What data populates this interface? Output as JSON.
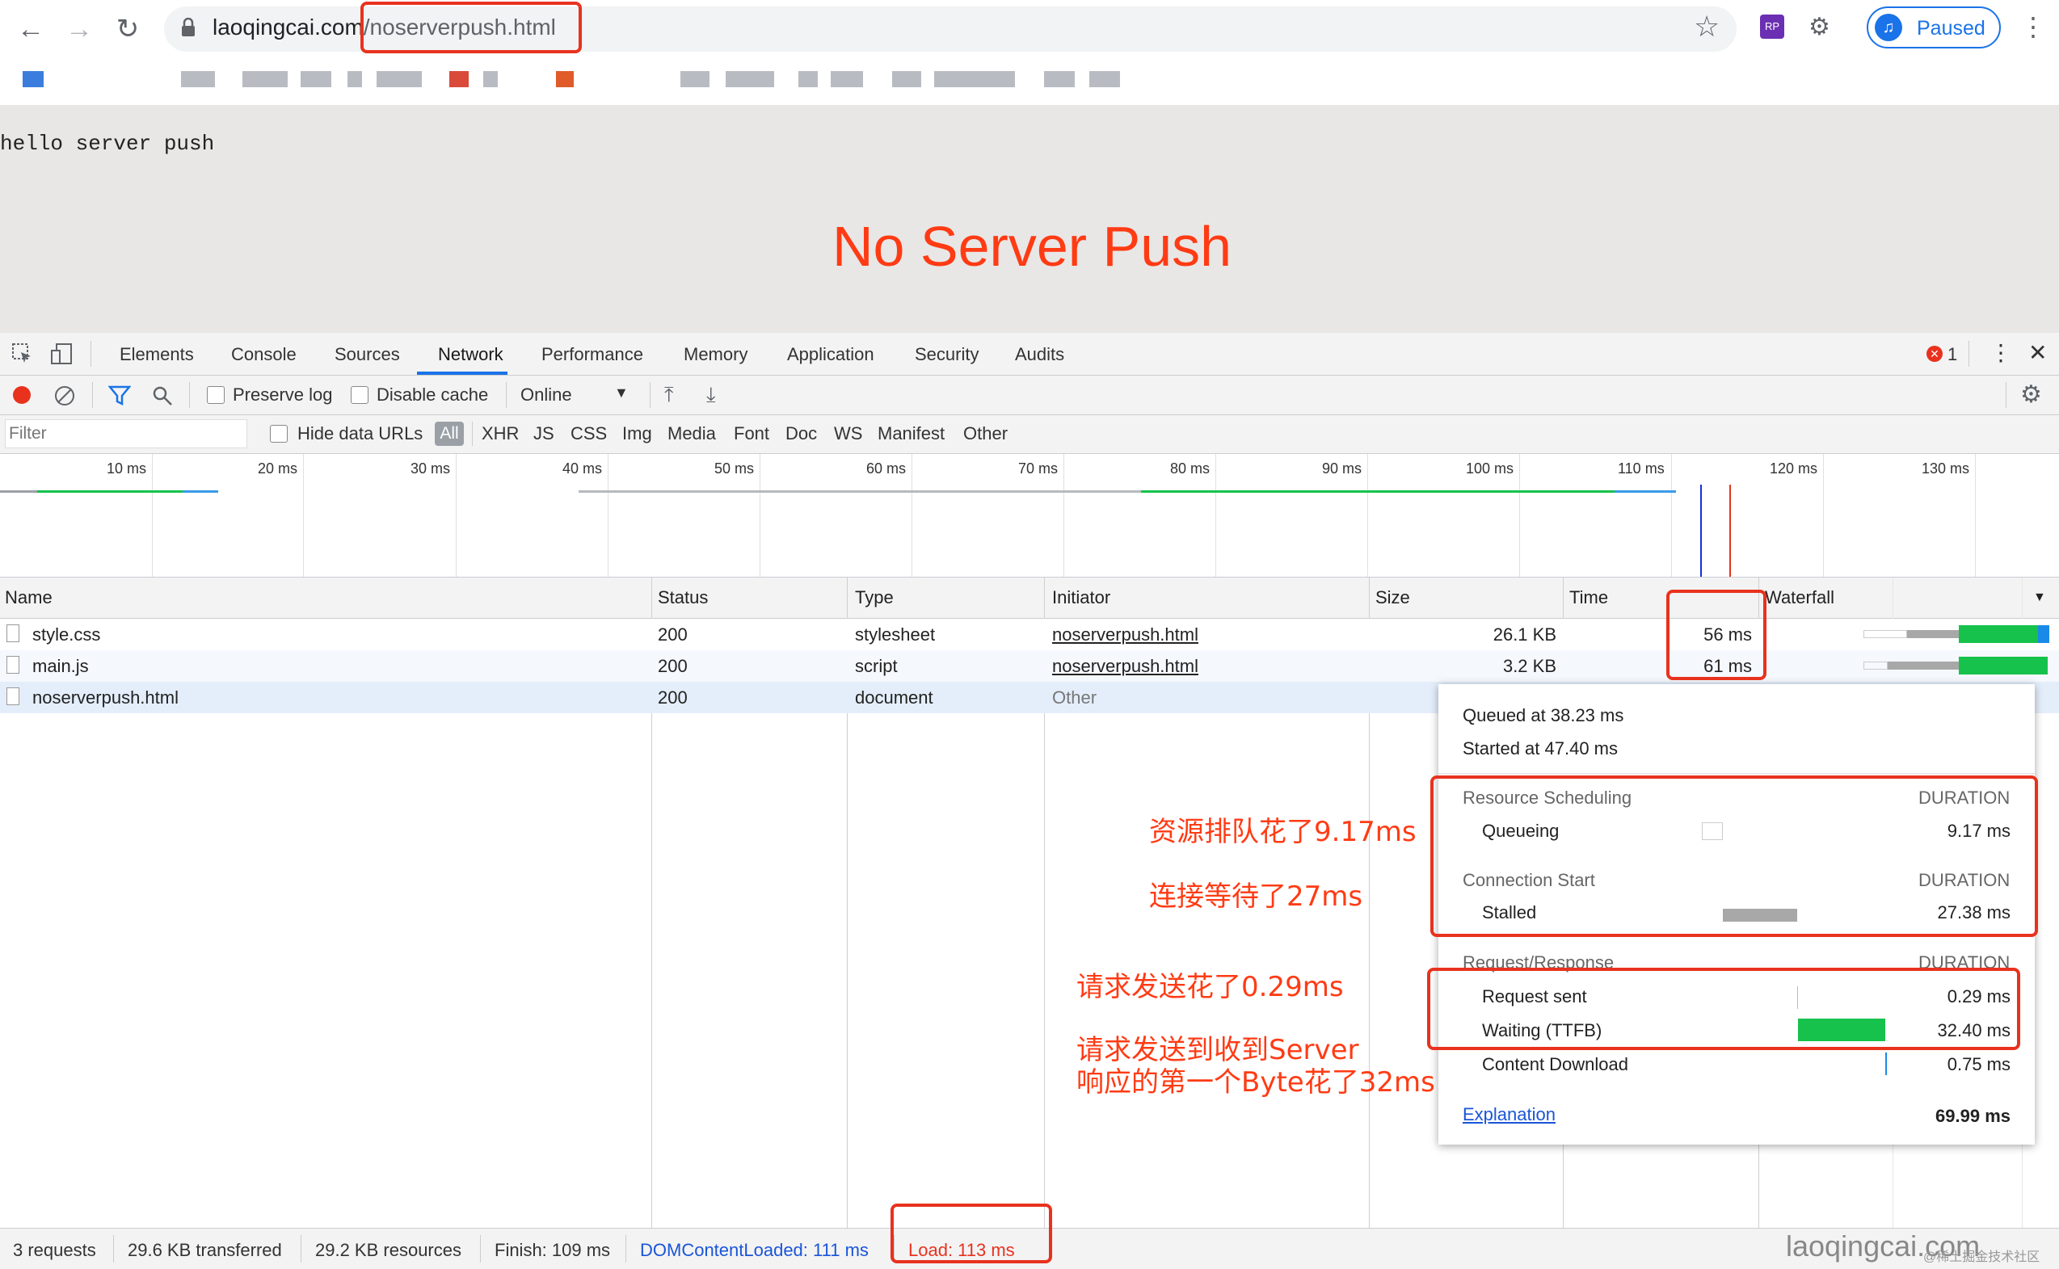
{
  "browser": {
    "url_host": "laoqingcai.com",
    "url_path": "/noserverpush.html",
    "profile_label": "Paused",
    "extension_label": "RP"
  },
  "page": {
    "body_text": "hello server push",
    "heading": "No Server Push"
  },
  "devtools": {
    "tabs": [
      "Elements",
      "Console",
      "Sources",
      "Network",
      "Performance",
      "Memory",
      "Application",
      "Security",
      "Audits"
    ],
    "active_tab": "Network",
    "error_count": "1",
    "toolbar": {
      "preserve_log": "Preserve log",
      "disable_cache": "Disable cache",
      "throttle": "Online"
    },
    "filter": {
      "placeholder": "Filter",
      "hide_data_urls": "Hide data URLs",
      "all": "All",
      "types": [
        "XHR",
        "JS",
        "CSS",
        "Img",
        "Media",
        "Font",
        "Doc",
        "WS",
        "Manifest",
        "Other"
      ]
    },
    "overview_ticks": [
      "10 ms",
      "20 ms",
      "30 ms",
      "40 ms",
      "50 ms",
      "60 ms",
      "70 ms",
      "80 ms",
      "90 ms",
      "100 ms",
      "110 ms",
      "120 ms",
      "130 ms"
    ],
    "columns": [
      "Name",
      "Status",
      "Type",
      "Initiator",
      "Size",
      "Time",
      "Waterfall"
    ],
    "rows": [
      {
        "name": "style.css",
        "status": "200",
        "type": "stylesheet",
        "initiator": "noserverpush.html",
        "size": "26.1 KB",
        "time": "56 ms"
      },
      {
        "name": "main.js",
        "status": "200",
        "type": "script",
        "initiator": "noserverpush.html",
        "size": "3.2 KB",
        "time": "61 ms"
      },
      {
        "name": "noserverpush.html",
        "status": "200",
        "type": "document",
        "initiator": "Other",
        "size": "",
        "time": ""
      }
    ],
    "timing_popup": {
      "queued_at": "Queued at 38.23 ms",
      "started_at": "Started at 47.40 ms",
      "resource_scheduling": "Resource Scheduling",
      "duration_label": "DURATION",
      "queueing": "Queueing",
      "queueing_value": "9.17 ms",
      "connection_start": "Connection Start",
      "stalled": "Stalled",
      "stalled_value": "27.38 ms",
      "request_response": "Request/Response",
      "request_sent": "Request sent",
      "request_sent_value": "0.29 ms",
      "waiting": "Waiting (TTFB)",
      "waiting_value": "32.40 ms",
      "content_download": "Content Download",
      "content_download_value": "0.75 ms",
      "explanation": "Explanation",
      "total": "69.99 ms"
    },
    "status_bar": {
      "requests": "3 requests",
      "transferred": "29.6 KB transferred",
      "resources": "29.2 KB resources",
      "finish": "Finish: 109 ms",
      "dcl": "DOMContentLoaded: 111 ms",
      "load": "Load: 113 ms"
    }
  },
  "annotations": {
    "queueing_note": "资源排队花了9.17ms",
    "stalled_note": "连接等待了27ms",
    "request_note": "请求发送花了0.29ms",
    "ttfb_note_line1": "请求发送到收到Server",
    "ttfb_note_line2": "响应的第一个Byte花了32ms",
    "watermark": "laoqingcai.com",
    "watermark_small": "@稀土掘金技术社区"
  },
  "colors": {
    "annotation_red": "#ff3b14",
    "active_tab_blue": "#1a73e8",
    "ttfb_green": "#16c24b",
    "dcl_blue": "#1a55d8",
    "load_red": "#e8321e"
  }
}
